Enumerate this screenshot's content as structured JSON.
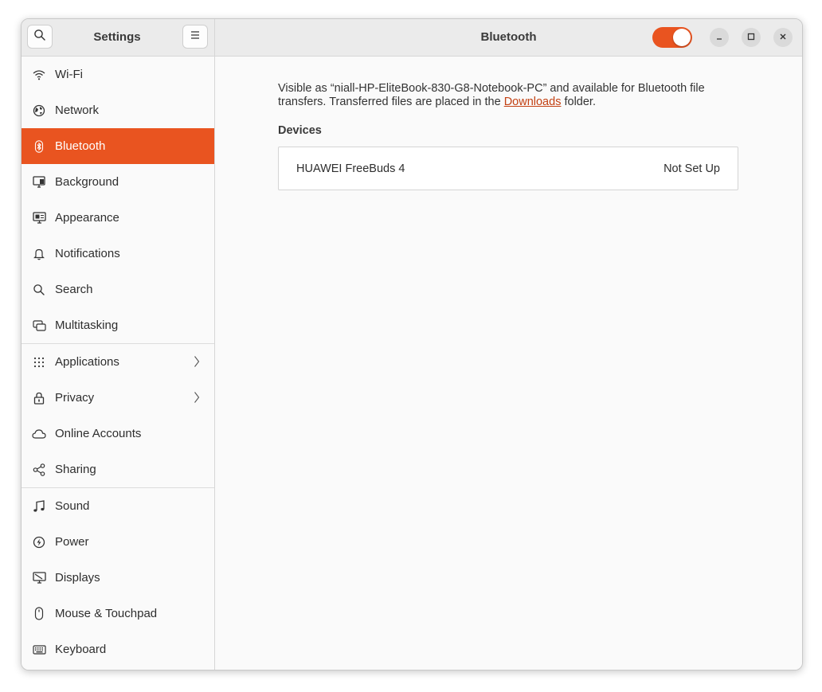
{
  "header": {
    "sidebar_title": "Settings",
    "page_title": "Bluetooth",
    "bluetooth_enabled": true,
    "accent_color": "#e95420"
  },
  "sidebar": {
    "groups": [
      [
        {
          "label": "Wi-Fi",
          "icon": "wifi-icon"
        },
        {
          "label": "Network",
          "icon": "network-icon"
        },
        {
          "label": "Bluetooth",
          "icon": "bluetooth-icon",
          "active": true
        },
        {
          "label": "Background",
          "icon": "background-icon"
        },
        {
          "label": "Appearance",
          "icon": "appearance-icon"
        },
        {
          "label": "Notifications",
          "icon": "bell-icon"
        },
        {
          "label": "Search",
          "icon": "search-icon"
        },
        {
          "label": "Multitasking",
          "icon": "multitasking-icon"
        }
      ],
      [
        {
          "label": "Applications",
          "icon": "apps-grid-icon",
          "has_submenu": true
        },
        {
          "label": "Privacy",
          "icon": "lock-icon",
          "has_submenu": true
        },
        {
          "label": "Online Accounts",
          "icon": "cloud-icon"
        },
        {
          "label": "Sharing",
          "icon": "share-icon"
        }
      ],
      [
        {
          "label": "Sound",
          "icon": "music-note-icon"
        },
        {
          "label": "Power",
          "icon": "power-icon"
        },
        {
          "label": "Displays",
          "icon": "display-icon"
        },
        {
          "label": "Mouse & Touchpad",
          "icon": "mouse-icon"
        },
        {
          "label": "Keyboard",
          "icon": "keyboard-icon"
        }
      ]
    ]
  },
  "main": {
    "visible_prefix": "Visible as “niall-HP-EliteBook-830-G8-Notebook-PC” and available for Bluetooth file transfers. Transferred files are placed in the ",
    "downloads_link": "Downloads",
    "visible_suffix": " folder.",
    "devices_heading": "Devices",
    "devices": [
      {
        "name": "HUAWEI FreeBuds 4",
        "status": "Not Set Up"
      }
    ]
  }
}
